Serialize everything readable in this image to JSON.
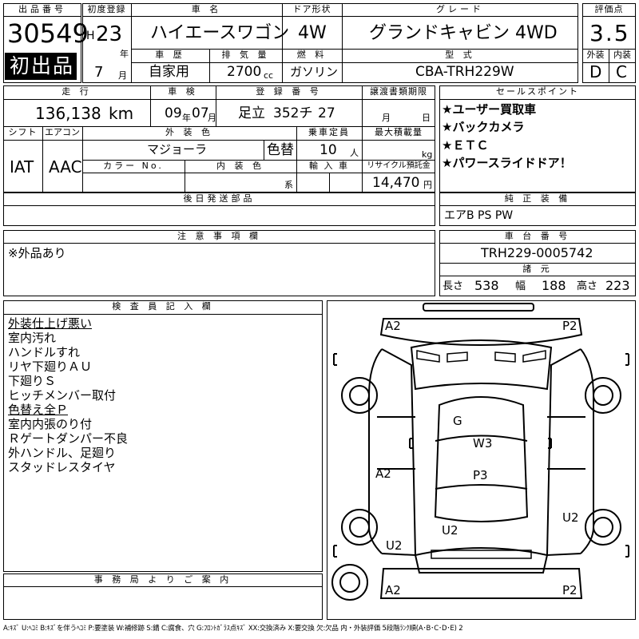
{
  "lot": {
    "label": "出品番号",
    "number": "30549"
  },
  "first_listing": "初出品",
  "registration": {
    "label": "初度登録",
    "era": "H",
    "year": "23",
    "year_unit": "年",
    "month": "7",
    "month_unit": "月"
  },
  "car_name": {
    "label": "車 名",
    "value": "ハイエースワゴン"
  },
  "door": {
    "label": "ドア形状",
    "value": "4W"
  },
  "grade": {
    "label": "グレード",
    "value": "グランドキャビン 4WD"
  },
  "score": {
    "label": "評価点",
    "value": "3.5"
  },
  "history": {
    "label": "車 歴",
    "value": "自家用"
  },
  "displacement": {
    "label": "排 気 量",
    "value": "2700",
    "unit": "cc"
  },
  "fuel": {
    "label": "燃 料",
    "value": "ガソリン"
  },
  "model_code": {
    "label": "型 式",
    "value": "CBA-TRH229W"
  },
  "exterior_grade": {
    "label": "外装",
    "value": "D"
  },
  "interior_grade": {
    "label": "内装",
    "value": "C"
  },
  "mileage": {
    "label": "走 行",
    "value": "136,138",
    "unit": "km"
  },
  "inspection": {
    "label": "車 検",
    "year": "09",
    "year_unit": "年",
    "month": "07",
    "month_unit": "月"
  },
  "plate": {
    "label": "登 録 番 号",
    "region": "足立",
    "class": "352チ",
    "number": "27"
  },
  "transfer_deadline": {
    "label": "譲渡書類期限",
    "month_unit": "月",
    "day_unit": "日"
  },
  "sales_points": {
    "label": "セールスポイント",
    "items": [
      "★ユーザー買取車",
      "★バックカメラ",
      "★ＥＴＣ",
      "★パワースライドドア！"
    ]
  },
  "shift": {
    "label": "シフト",
    "value": "IAT"
  },
  "aircon": {
    "label": "エアコン",
    "value": "AAC"
  },
  "exterior_color": {
    "label": "外 装 色",
    "value": "マジョーラ",
    "repaint": "色替"
  },
  "capacity": {
    "label": "乗車定員",
    "value": "10",
    "unit": "人"
  },
  "max_load": {
    "label": "最大積載量",
    "unit": "kg"
  },
  "color_no": {
    "label": "カラー No."
  },
  "interior_color": {
    "label": "内 装 色",
    "suffix": "系"
  },
  "import": {
    "label": "輸 入 車"
  },
  "recycle": {
    "label": "リサイクル預託金",
    "value": "14,470",
    "unit": "円"
  },
  "later_parts": {
    "label": "後日発送部品"
  },
  "genuine_equipment": {
    "label": "純 正 装 備",
    "value": "エアB PS PW"
  },
  "caution": {
    "label": "注 意 事 項 欄",
    "value": "※外品あり"
  },
  "chassis": {
    "label": "車 台 番 号",
    "value": "TRH229-0005742"
  },
  "dimensions": {
    "label": "諸 元",
    "length_label": "長さ",
    "length": "538",
    "width_label": "幅",
    "width": "188",
    "height_label": "高さ",
    "height": "223"
  },
  "inspector_notes": {
    "label": "検 査 員 記 入 欄",
    "lines": [
      "外装仕上げ悪い",
      "室内汚れ",
      "ハンドルすれ",
      "リヤ下廻りＡＵ",
      "下廻りＳ",
      "ヒッチメンバー取付",
      "色替え全Ｐ",
      "室内内張のり付",
      "Ｒゲートダンパー不良",
      "外ハンドル、足廻り",
      "スタッドレスタイヤ"
    ]
  },
  "office_notice": {
    "label": "事 務 局 よ り ご 案 内"
  },
  "diagram_marks": {
    "front_left": "A2",
    "front_right": "P2",
    "hood": "G",
    "windshield": "W3",
    "roof": "P3",
    "left_side": "A2",
    "right_side": "U2",
    "rear_center": "U2",
    "rear_left": "U2",
    "rear_bumper_left": "A2",
    "rear_bumper_right": "P2"
  },
  "legend": "A:ｷｽﾞ U:ﾍｺﾐ B:ｷｽﾞを伴うﾍｺﾐ P:要塗装 W:補修跡 S:錆 C:腐食、穴 G:ﾌﾛﾝﾄｶﾞﾗｽ点ｷｽﾞ XX:交換済み X:要交換 欠:欠品 内・外装評価 5段階ﾗﾝｸ順(A･B･C･D･E) 2"
}
